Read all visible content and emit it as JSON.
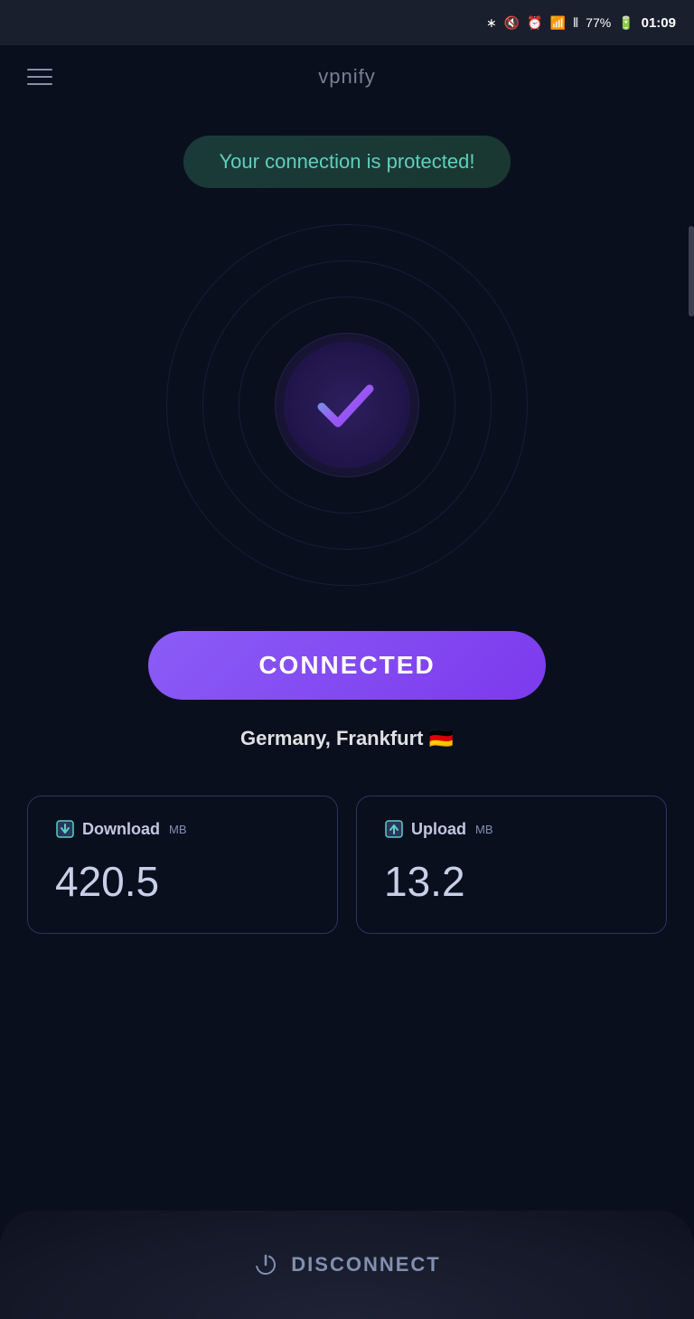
{
  "statusBar": {
    "battery": "77%",
    "time": "01:09",
    "icons": [
      "bluetooth",
      "mute",
      "alarm",
      "wifi",
      "signal"
    ]
  },
  "nav": {
    "title": "vpnify",
    "menuIcon": "hamburger"
  },
  "main": {
    "protectionBadge": "Your connection is protected!",
    "connectedButton": "CONNECTED",
    "location": "Germany, Frankfurt 🇩🇪",
    "download": {
      "label": "Download",
      "unit": "MB",
      "value": "420.5"
    },
    "upload": {
      "label": "Upload",
      "unit": "MB",
      "value": "13.2"
    }
  },
  "footer": {
    "disconnectLabel": "DISCONNECT"
  },
  "colors": {
    "accent": "#8b5cf6",
    "teal": "#5ecfbe",
    "cardBorder": "#2a3560",
    "textMuted": "#8090b0"
  }
}
